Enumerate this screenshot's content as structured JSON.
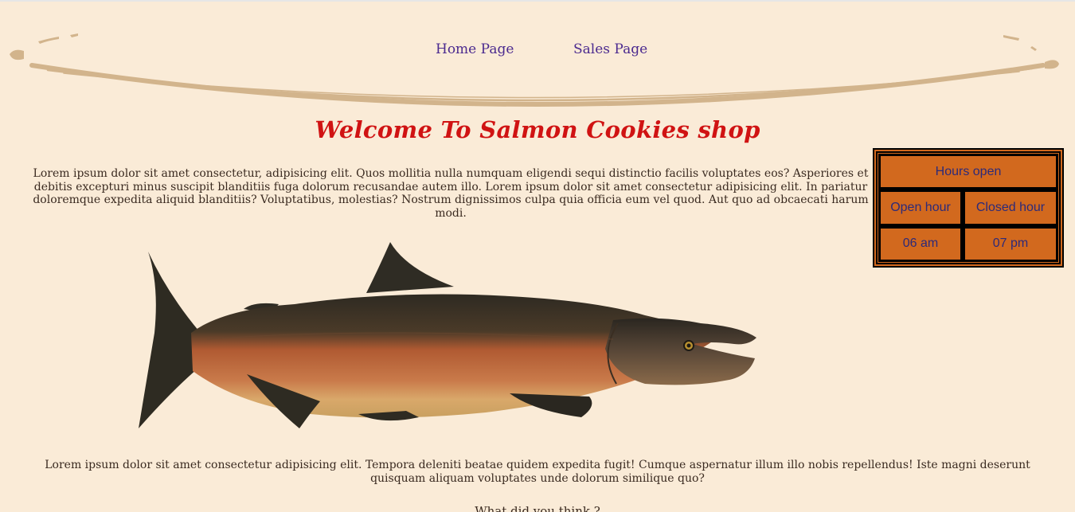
{
  "nav": {
    "home_label": "Home Page",
    "sales_label": "Sales Page"
  },
  "title": "Welcome To Salmon Cookies shop",
  "intro_text": "Lorem ipsum dolor sit amet consectetur, adipisicing elit. Quos mollitia nulla numquam eligendi sequi distinctio facilis voluptates eos? Asperiores et debitis excepturi minus suscipit blanditiis fuga dolorum recusandae autem illo. Lorem ipsum dolor sit amet consectetur adipisicing elit. In pariatur doloremque expedita aliquid blanditiis? Voluptatibus, molestias? Nostrum dignissimos culpa quia officia eum vel quod. Aut quo ad obcaecati harum modi.",
  "hours": {
    "heading": "Hours open",
    "open_label": "Open hour",
    "closed_label": "Closed hour",
    "open_value": "06 am",
    "closed_value": "07 pm"
  },
  "outro_text": "Lorem ipsum dolor sit amet consectetur adipisicing elit. Tempora deleniti beatae quidem expedita fugit! Cumque aspernatur illum illo nobis repellendus! Iste magni deserunt quisquam aliquam voluptates unde dolorum similique quo?",
  "question_text": "What did you think ?",
  "colors": {
    "background": "#FAEBD7",
    "title": "#d01313",
    "nav_link": "#4b2a8f",
    "table_fill": "#D2691E",
    "banner_stroke": "#D2B48C"
  }
}
